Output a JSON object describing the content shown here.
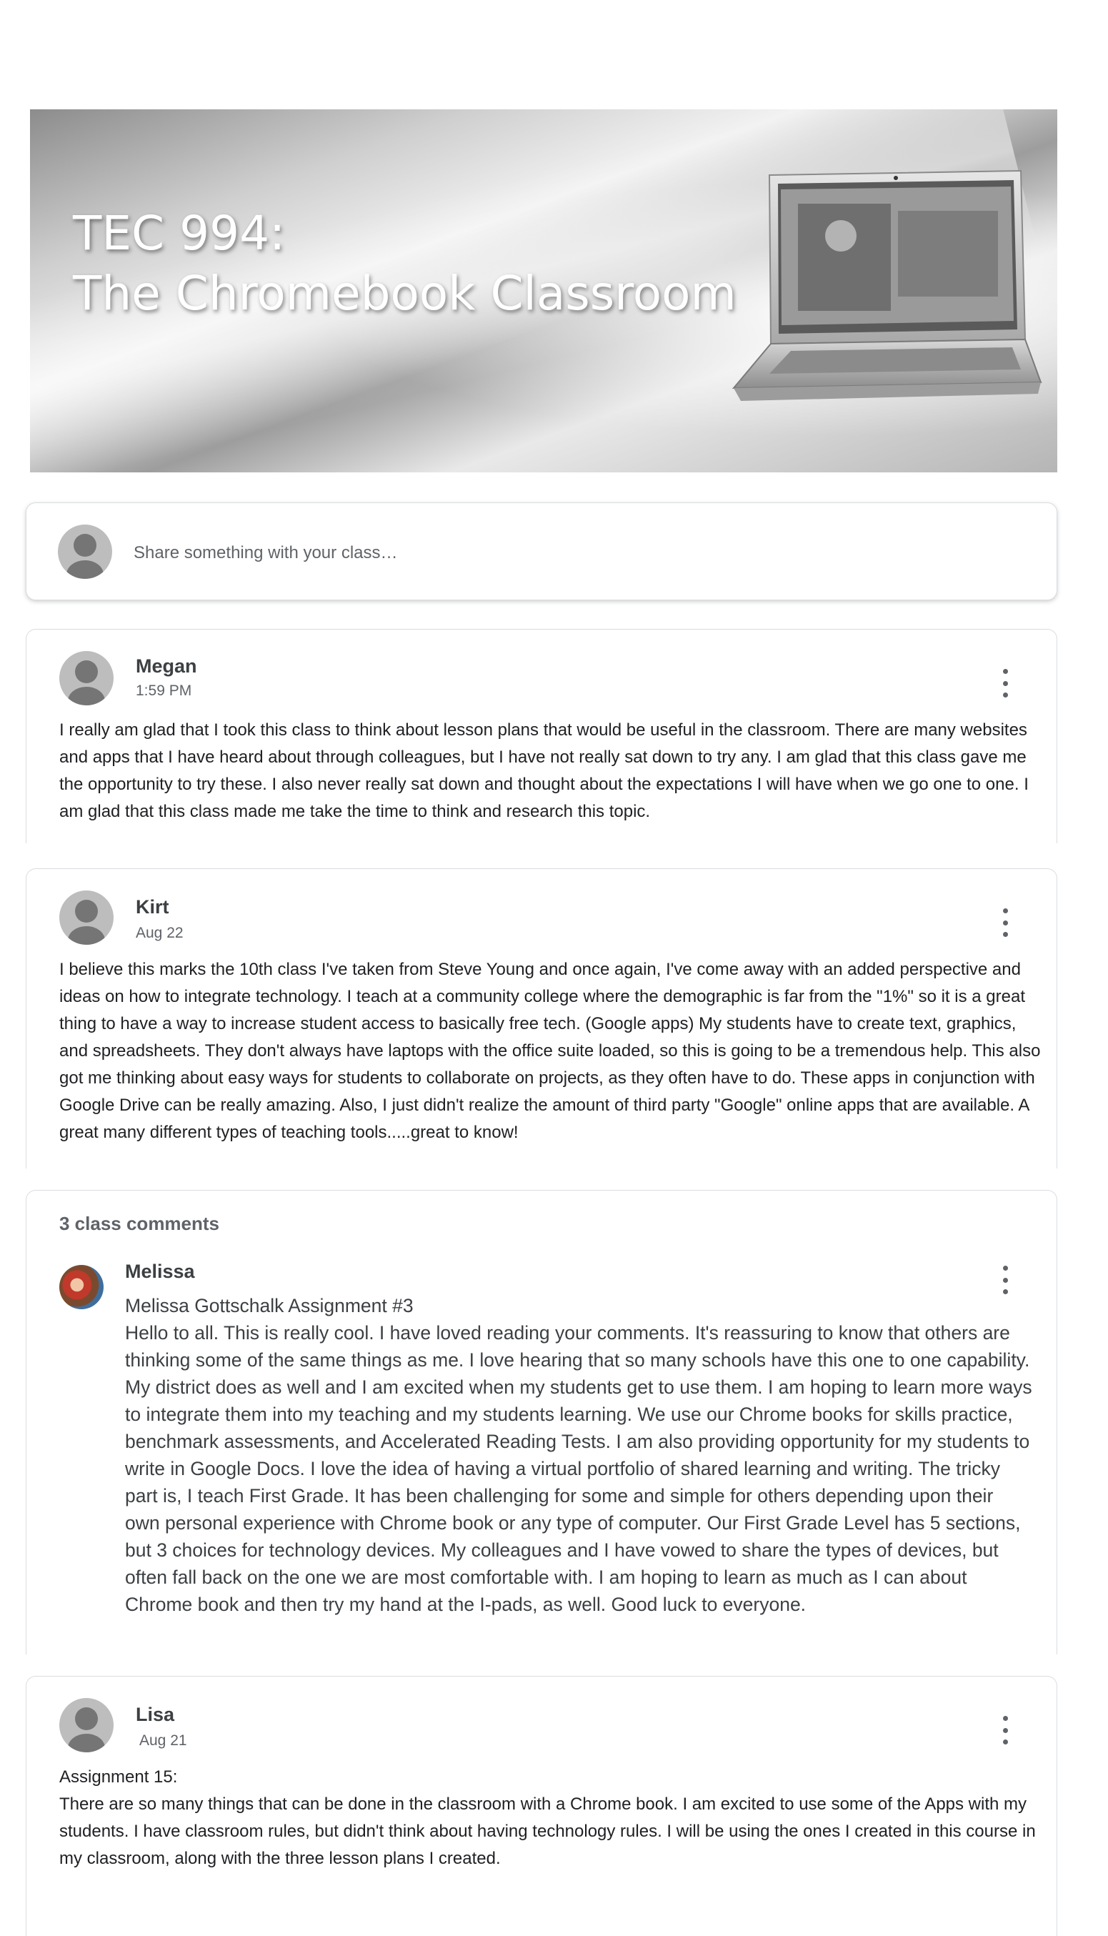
{
  "banner": {
    "title_line1": "TEC 994:",
    "title_line2": "The Chromebook Classroom"
  },
  "share": {
    "placeholder": "Share something with your class…"
  },
  "posts": [
    {
      "author": "Megan",
      "time": "1:59 PM",
      "body": "I really am glad that I took this class to think about lesson plans that would be useful in the classroom. There are many websites and apps that I have heard about through colleagues, but I have not really sat down to try any. I am glad that this class gave me the opportunity to try these. I also never really sat down and thought about the expectations I will have when we go one to one. I am glad that this class made me take the time to think and research this topic."
    },
    {
      "author": "Kirt",
      "time": "Aug 22",
      "body": "I believe this marks the 10th class I've taken from Steve Young and once again, I've come away with an added perspective and ideas on how to integrate technology. I teach at a community college where the demographic is far from the \"1%\" so it is a great thing to have a way to increase student access to basically free tech. (Google apps) My students have to create text, graphics, and spreadsheets. They don't always have laptops with the office suite loaded, so this is going to be a tremendous help. This also got me thinking about easy ways for students to collaborate on projects, as they often have to do. These apps in conjunction with Google Drive can be really amazing. Also, I just didn't realize the amount of third party \"Google\" online apps that are available. A great many different types of teaching tools.....great to know!"
    },
    {
      "author": "Lisa",
      "time": "Aug 21",
      "body_line1": "Assignment 15:",
      "body": "There are so many things that can be done in the classroom with a Chrome book. I am excited to use some of the Apps with my students. I have classroom rules, but didn't think about having technology rules. I will be using the ones I created in this course in my classroom, along with the three lesson plans I created."
    }
  ],
  "comments": {
    "header": "3 class comments",
    "items": [
      {
        "author": "Melissa",
        "title": "Melissa Gottschalk Assignment #3",
        "body": "Hello to all. This is really cool. I have loved reading your comments. It's reassuring to know that others are thinking some of the same things as me. I love hearing that so many schools have this one to one capability. My district does as well and I am excited when my students get to use them. I am hoping to learn more ways to integrate them into my teaching and my students learning. We use our Chrome books for skills practice, benchmark assessments, and Accelerated Reading Tests. I am also providing opportunity for my students to write in Google Docs. I love the idea of having a virtual portfolio of shared learning and writing. The tricky part is, I teach First Grade. It has been challenging for some and simple for others depending upon their own personal experience with Chrome book or any type of computer. Our First Grade Level has 5 sections, but 3 choices for technology devices. My colleagues and I have vowed to share the types of devices, but often fall back on the one we are most comfortable with. I am hoping to learn as much as I can about Chrome book and then try my hand at the I-pads, as well. Good luck to everyone."
      }
    ]
  },
  "icons": {
    "more": "more-vert-icon",
    "avatar": "default-avatar-icon"
  }
}
